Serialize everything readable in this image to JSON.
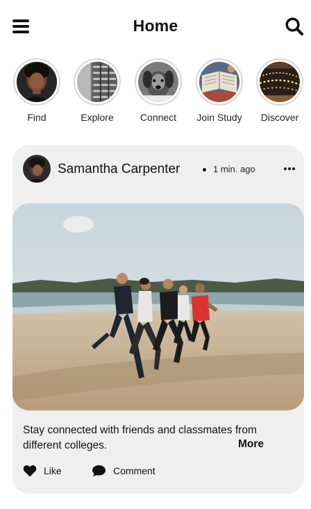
{
  "header": {
    "title": "Home",
    "menu_icon": "hamburger-menu-icon",
    "search_icon": "search-icon"
  },
  "stories": [
    {
      "label": "Find",
      "image": "portrait of a woman"
    },
    {
      "label": "Explore",
      "image": "building facade"
    },
    {
      "label": "Connect",
      "image": "dog"
    },
    {
      "label": "Join Study",
      "image": "open book"
    },
    {
      "label": "Discover",
      "image": "string lights"
    }
  ],
  "post": {
    "author": "Samantha Carpenter",
    "time": "1 min. ago",
    "more_options_icon": "more-horizontal-icon",
    "image": "group of people running on a beach",
    "caption": "Stay connected with friends and classmates from different colleges.",
    "more_label": "More",
    "actions": {
      "like_label": "Like",
      "like_icon": "heart-icon",
      "comment_label": "Comment",
      "comment_icon": "comment-bubble-icon"
    }
  },
  "colors": {
    "background": "#ffffff",
    "card": "#efefef",
    "text": "#111111"
  }
}
